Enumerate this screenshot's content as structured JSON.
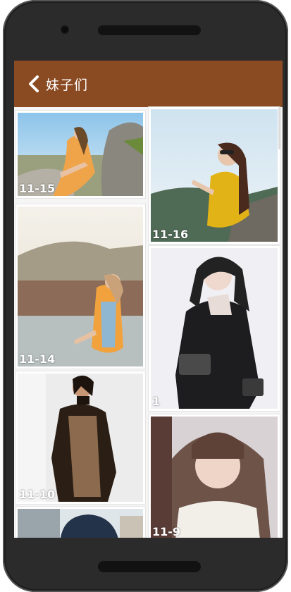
{
  "appbar": {
    "title": "妹子们",
    "back_icon": "chevron-left-icon"
  },
  "photos": [
    {
      "date": "11-15"
    },
    {
      "date": "11-16"
    },
    {
      "date": "11-14"
    },
    {
      "date": "1"
    },
    {
      "date": "11-10"
    },
    {
      "date": "11-9"
    }
  ],
  "colors": {
    "appbar": "#8a4a22",
    "screen_bg": "#f5f5f5"
  }
}
